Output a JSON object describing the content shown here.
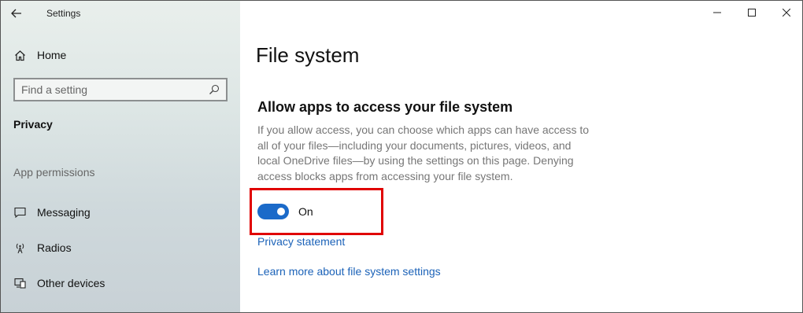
{
  "titlebar": {
    "back_icon": "back-arrow-icon",
    "app_title": "Settings",
    "controls": {
      "minimize_icon": "minimize-icon",
      "maximize_icon": "maximize-icon",
      "close_icon": "close-icon"
    }
  },
  "sidebar": {
    "home": {
      "label": "Home",
      "icon": "home-icon"
    },
    "search": {
      "placeholder": "Find a setting",
      "icon": "search-icon"
    },
    "section_title": "Privacy",
    "group_title": "App permissions",
    "items": [
      {
        "label": "Messaging",
        "icon": "message-icon"
      },
      {
        "label": "Radios",
        "icon": "radio-tower-icon"
      },
      {
        "label": "Other devices",
        "icon": "devices-icon"
      }
    ]
  },
  "main": {
    "page_title": "File system",
    "heading": "Allow apps to access your file system",
    "description": "If you allow access, you can choose which apps can have access to all of your files—including your documents, pictures, videos, and local OneDrive files—by using the settings on this page. Denying access blocks apps from accessing your file system.",
    "toggle": {
      "state_label": "On",
      "on": true
    },
    "links": {
      "privacy_statement": "Privacy statement",
      "learn_more": "Learn more about file system settings"
    }
  },
  "colors": {
    "accent": "#1b6ac9",
    "link": "#1b62b8",
    "highlight": "#e00000"
  }
}
